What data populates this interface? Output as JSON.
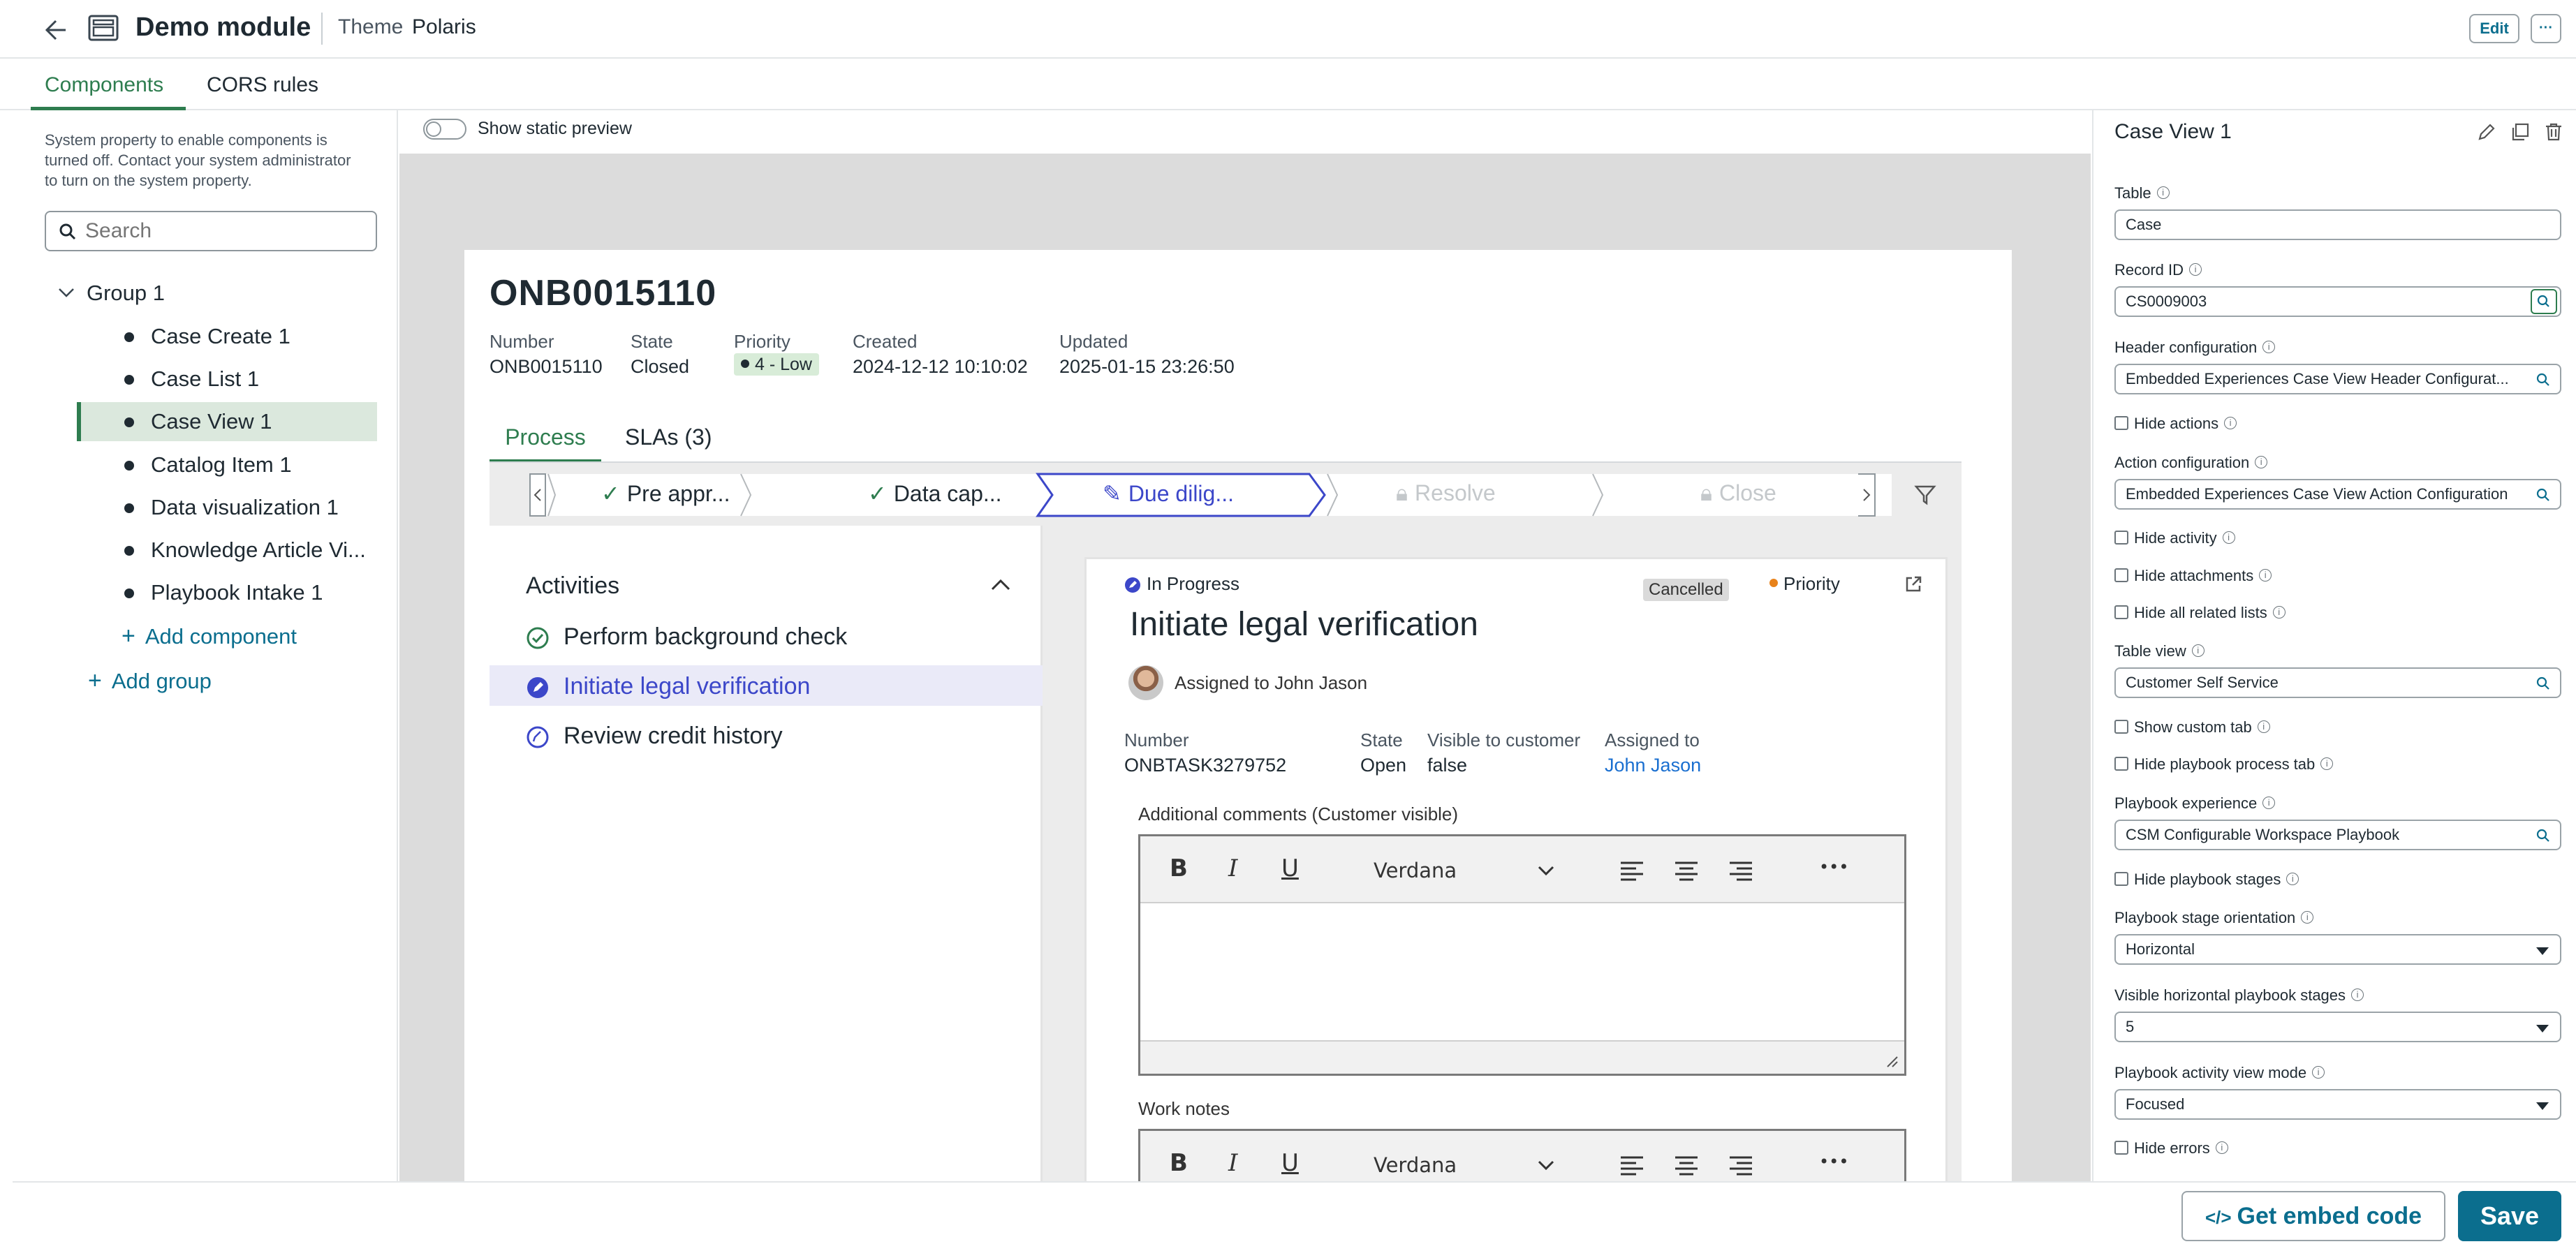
{
  "header": {
    "module_title": "Demo module",
    "theme_label": "Theme",
    "theme_value": "Polaris",
    "edit_label": "Edit",
    "more_label": "···"
  },
  "tabs": [
    {
      "label": "Components",
      "active": true
    },
    {
      "label": "CORS rules",
      "active": false
    }
  ],
  "sidebar": {
    "notice": [
      "System property to enable components is",
      "turned off. Contact your system administrator",
      "to turn on the system property."
    ],
    "search_placeholder": "Search",
    "group": {
      "label": "Group 1",
      "items": [
        {
          "label": "Case Create 1"
        },
        {
          "label": "Case List 1"
        },
        {
          "label": "Case View 1",
          "selected": true
        },
        {
          "label": "Catalog Item 1"
        },
        {
          "label": "Data visualization 1"
        },
        {
          "label": "Knowledge Article Vi..."
        },
        {
          "label": "Playbook Intake 1"
        }
      ]
    },
    "add_component": "Add component",
    "add_group": "Add group"
  },
  "preview": {
    "toggle_label": "Show static preview",
    "record": {
      "number_title": "ONB0015110",
      "fields": [
        {
          "label": "Number",
          "value": "ONB0015110"
        },
        {
          "label": "State",
          "value": "Closed"
        },
        {
          "label": "Priority",
          "value": "4 - Low"
        },
        {
          "label": "Created",
          "value": "2024-12-12 10:10:02"
        },
        {
          "label": "Updated",
          "value": "2025-01-15 23:26:50"
        }
      ],
      "tabs": [
        {
          "label": "Process",
          "active": true
        },
        {
          "label": "SLAs (3)",
          "active": false
        }
      ],
      "stages": [
        {
          "label": "Pre appr...",
          "status": "done"
        },
        {
          "label": "Data cap...",
          "status": "done"
        },
        {
          "label": "Due dilig...",
          "status": "current"
        },
        {
          "label": "Resolve",
          "status": "locked"
        },
        {
          "label": "Close",
          "status": "locked"
        }
      ],
      "activities": {
        "title": "Activities",
        "items": [
          {
            "label": "Perform background check",
            "status": "done"
          },
          {
            "label": "Initiate legal verification",
            "status": "current"
          },
          {
            "label": "Review credit history",
            "status": "pending"
          }
        ]
      },
      "task": {
        "status": "In Progress",
        "badge": "Cancelled",
        "priority_label": "Priority",
        "title": "Initiate legal verification",
        "assigned_text": "Assigned to John Jason",
        "fields": [
          {
            "label": "Number",
            "value": "ONBTASK3279752"
          },
          {
            "label": "State",
            "value": "Open"
          },
          {
            "label": "Visible to customer",
            "value": "false"
          },
          {
            "label": "Assigned to",
            "value": "John Jason"
          }
        ],
        "comments_label": "Additional comments (Customer visible)",
        "work_notes_label": "Work notes",
        "font_name": "Verdana",
        "toolbar": {
          "bold": "B",
          "italic": "I",
          "underline": "U",
          "more": "•••"
        }
      }
    }
  },
  "properties": {
    "title": "Case View 1",
    "table_label": "Table",
    "table_value": "Case",
    "record_id_label": "Record ID",
    "record_id_value": "CS0009003",
    "header_config_label": "Header configuration",
    "header_config_value": "Embedded Experiences Case View Header Configurat...",
    "hide_actions": "Hide actions",
    "action_config_label": "Action configuration",
    "action_config_value": "Embedded Experiences Case View Action Configuration",
    "hide_activity": "Hide activity",
    "hide_attachments": "Hide attachments",
    "hide_related_lists": "Hide all related lists",
    "table_view_label": "Table view",
    "table_view_value": "Customer Self Service",
    "show_custom_tab": "Show custom tab",
    "hide_playbook_tab": "Hide playbook process tab",
    "playbook_exp_label": "Playbook experience",
    "playbook_exp_value": "CSM Configurable Workspace Playbook",
    "hide_playbook_stages": "Hide playbook stages",
    "stage_orientation_label": "Playbook stage orientation",
    "stage_orientation_value": "Horizontal",
    "visible_stages_label": "Visible horizontal playbook stages",
    "visible_stages_value": "5",
    "activity_view_label": "Playbook activity view mode",
    "activity_view_value": "Focused",
    "hide_errors": "Hide errors"
  },
  "footer": {
    "embed_label": "Get embed code",
    "save_label": "Save"
  },
  "colors": {
    "accent": "#2e7d4f",
    "brand_blue": "#0b6e8e",
    "stage_blue": "#3c47c9",
    "selected_bg": "#dbe8dd"
  }
}
